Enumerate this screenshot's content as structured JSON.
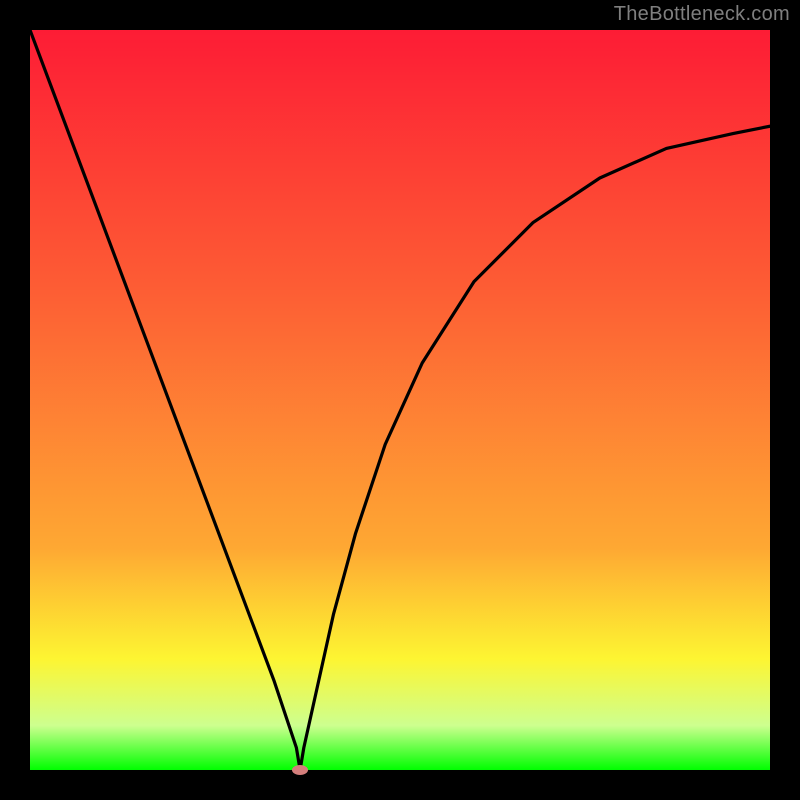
{
  "watermark": {
    "text": "TheBottleneck.com",
    "top": 3,
    "right": 10
  },
  "plot": {
    "axis_range_norm": {
      "xmin": 0,
      "xmax": 1,
      "ymin": 0,
      "ymax": 1
    },
    "gradient_stops_hex": [
      "#fd1c35",
      "#fd5d34",
      "#fea833",
      "#fdf532",
      "#cdff8f",
      "#00ff00"
    ],
    "marker": {
      "x_norm": 0.365,
      "y_norm": 0.0,
      "color": "#d47e7c"
    }
  },
  "chart_data": {
    "type": "line",
    "title": "",
    "xlabel": "",
    "ylabel": "",
    "xlim": [
      0,
      1
    ],
    "ylim": [
      0,
      1
    ],
    "grid": false,
    "legend": false,
    "note": "x and y are normalized to the visible plot area; curve is a V-shaped dip reaching its minimum (y≈0) near x≈0.365",
    "series": [
      {
        "name": "curve",
        "x": [
          0.0,
          0.03,
          0.06,
          0.09,
          0.12,
          0.15,
          0.18,
          0.21,
          0.24,
          0.27,
          0.3,
          0.33,
          0.36,
          0.365,
          0.37,
          0.39,
          0.41,
          0.44,
          0.48,
          0.53,
          0.6,
          0.68,
          0.77,
          0.86,
          0.95,
          1.0
        ],
        "y": [
          1.0,
          0.92,
          0.84,
          0.76,
          0.68,
          0.6,
          0.52,
          0.44,
          0.36,
          0.28,
          0.2,
          0.12,
          0.03,
          0.0,
          0.03,
          0.12,
          0.21,
          0.32,
          0.44,
          0.55,
          0.66,
          0.74,
          0.8,
          0.84,
          0.86,
          0.87
        ]
      }
    ],
    "marker_point": {
      "x": 0.365,
      "y": 0.0
    }
  }
}
